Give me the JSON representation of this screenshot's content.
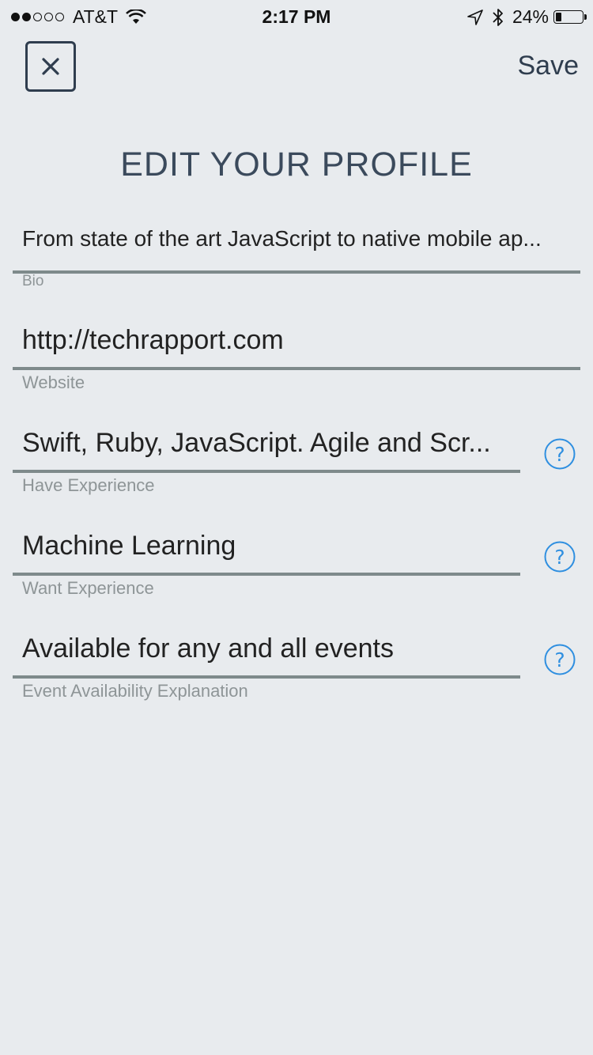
{
  "status_bar": {
    "signal_bars_total": 5,
    "signal_bars_filled": 2,
    "carrier": "AT&T",
    "time": "2:17 PM",
    "battery_percent_label": "24%",
    "battery_level": 0.24
  },
  "header": {
    "close_icon": "close-icon",
    "save_label": "Save",
    "title": "EDIT YOUR PROFILE"
  },
  "form": {
    "bio": {
      "value": "From state of the art JavaScript to native mobile ap...",
      "label": "Bio"
    },
    "website": {
      "value": "http://techrapport.com",
      "label": "Website"
    },
    "have_experience": {
      "value": "Swift, Ruby, JavaScript.  Agile and Scr...",
      "label": "Have Experience"
    },
    "want_experience": {
      "value": "Machine Learning",
      "label": "Want Experience"
    },
    "event_availability": {
      "value": "Available for any and all events",
      "label": "Event Availability Explanation"
    }
  },
  "colors": {
    "background": "#e8ebee",
    "accent_help": "#2f8fe0",
    "header_text": "#2f3d4e",
    "underline": "#7e8a8b",
    "label_text": "#8e9597"
  },
  "icons": [
    "close-icon",
    "help-icon",
    "wifi-icon",
    "location-arrow-icon",
    "bluetooth-icon",
    "battery-icon"
  ]
}
